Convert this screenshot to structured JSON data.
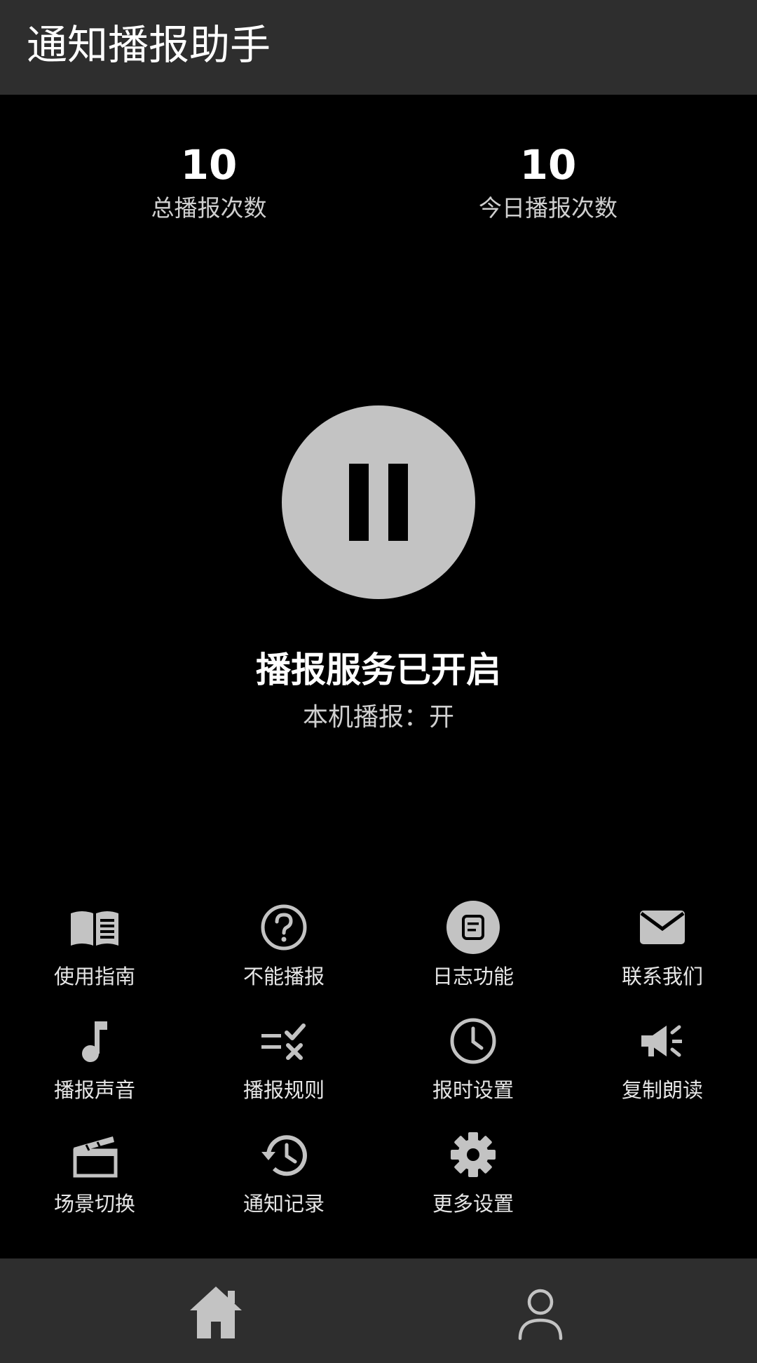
{
  "header": {
    "title": "通知播报助手"
  },
  "stats": {
    "total_value": "10",
    "total_label": "总播报次数",
    "today_value": "10",
    "today_label": "今日播报次数"
  },
  "status": {
    "service": "播报服务已开启",
    "local": "本机播报：开"
  },
  "menu": {
    "items": [
      {
        "label": "使用指南",
        "icon": "book-icon"
      },
      {
        "label": "不能播报",
        "icon": "question-icon"
      },
      {
        "label": "日志功能",
        "icon": "log-icon"
      },
      {
        "label": "联系我们",
        "icon": "mail-icon"
      },
      {
        "label": "播报声音",
        "icon": "music-note-icon"
      },
      {
        "label": "播报规则",
        "icon": "rules-icon"
      },
      {
        "label": "报时设置",
        "icon": "clock-icon"
      },
      {
        "label": "复制朗读",
        "icon": "megaphone-icon"
      },
      {
        "label": "场景切换",
        "icon": "clapperboard-icon"
      },
      {
        "label": "通知记录",
        "icon": "history-icon"
      },
      {
        "label": "更多设置",
        "icon": "gear-icon"
      }
    ]
  },
  "nav": {
    "items": [
      {
        "icon": "home-icon"
      },
      {
        "icon": "person-icon"
      }
    ]
  },
  "colors": {
    "background": "#000000",
    "bar": "#2e2e2e",
    "icon": "#c3c3c3",
    "text": "#ffffff",
    "subtext": "#cfcfcf"
  }
}
